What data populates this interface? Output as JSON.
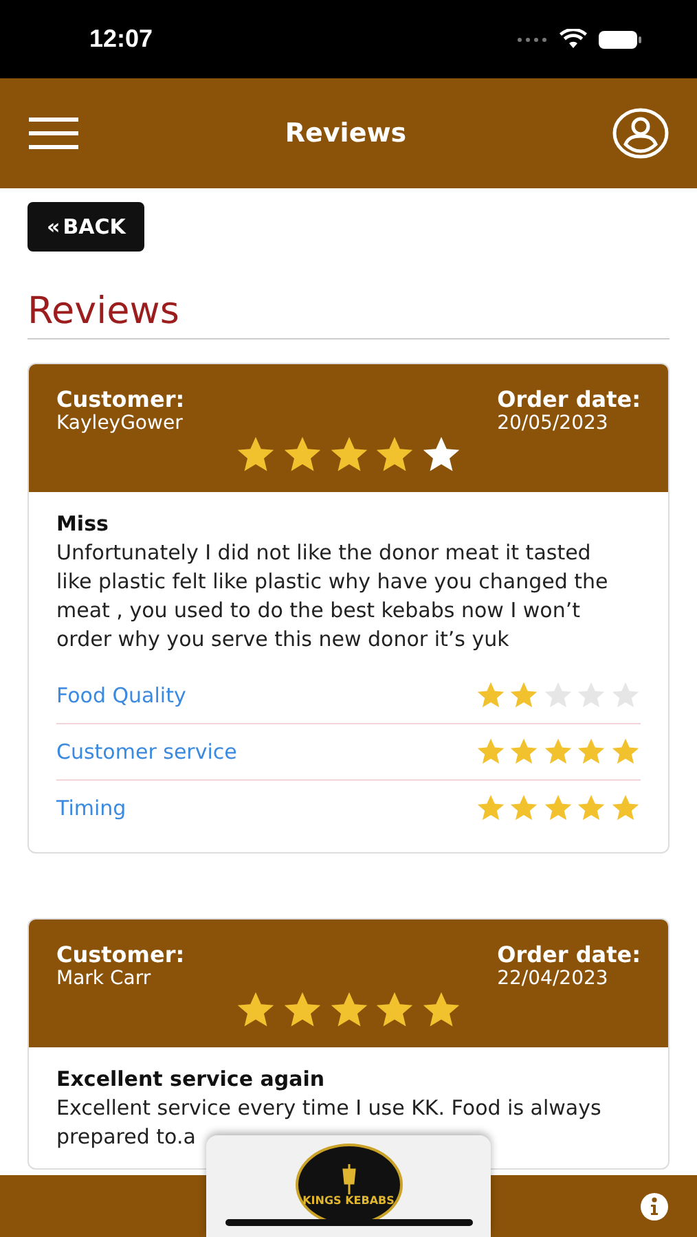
{
  "status_bar": {
    "time": "12:07"
  },
  "header": {
    "title": "Reviews"
  },
  "back_button": {
    "label": "BACK",
    "icon_text": "«"
  },
  "section_title": "Reviews",
  "reviews": [
    {
      "customer_label": "Customer:",
      "customer": "KayleyGower",
      "date_label": "Order date:",
      "date": "20/05/2023",
      "stars": 4,
      "title": "Miss",
      "body": "Unfortunately I did not like the donor meat it tasted like plastic felt like plastic why have you changed the meat , you used to do the best kebabs now I won’t order why you serve this new donor it’s yuk",
      "ratings": [
        {
          "label": "Food Quality",
          "stars": 2
        },
        {
          "label": "Customer service",
          "stars": 5
        },
        {
          "label": "Timing",
          "stars": 5
        }
      ]
    },
    {
      "customer_label": "Customer:",
      "customer": "Mark Carr",
      "date_label": "Order date:",
      "date": "22/04/2023",
      "stars": 5,
      "title": "Excellent service again",
      "body": "Excellent service every time I use KK. Food is always prepared to.a"
    }
  ],
  "footer": {
    "logo_text": "KINGS KEBABS"
  }
}
